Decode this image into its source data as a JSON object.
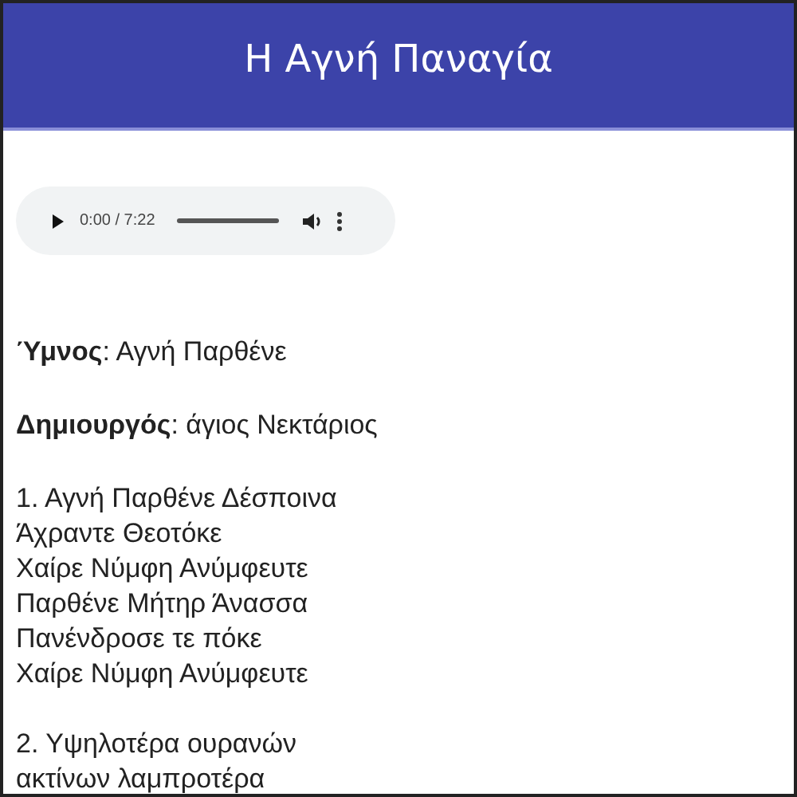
{
  "header": {
    "title": "Η Αγνή Παναγία"
  },
  "audio_player": {
    "time": "0:00 / 7:22"
  },
  "info": [
    "**Ύμνος**: Αγνή Παρθένε",
    "**Δημιουργός**: άγιος Νεκτάριος"
  ],
  "stanzas": [
    [
      "1. Αγνή Παρθένε Δέσποινα",
      "Άχραντε Θεοτόκε",
      "Χαίρε Νύμφη Ανύμφευτε",
      "Παρθένε Μήτηρ Άνασσα",
      "Πανένδροσε τε πόκε",
      "Χαίρε Νύμφη Ανύμφευτε"
    ],
    [
      "2. Υψηλοτέρα ουρανών",
      "ακτίνων λαμπροτέρα"
    ]
  ]
}
